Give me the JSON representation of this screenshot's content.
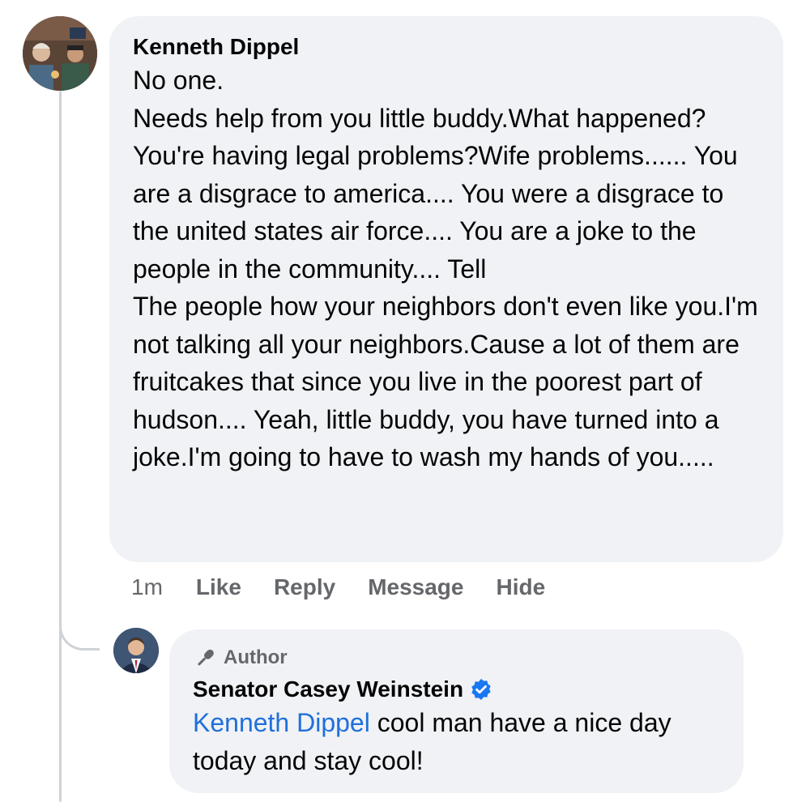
{
  "comment": {
    "author": "Kenneth Dippel",
    "paragraphs": [
      "No one.",
      "Needs help from you little buddy.What happened?You're having legal problems?Wife problems...... You are a disgrace to america.... You were a disgrace to the united states air force.... You are a joke to the people in the community.... Tell",
      "The people how your neighbors don't even like you.I'm not talking all your neighbors.Cause a lot of them are fruitcakes that since you live in the poorest part of hudson.... Yeah, little buddy, you have turned into a joke.I'm going to have to wash my hands of you....."
    ],
    "timestamp": "1m",
    "actions": {
      "like": "Like",
      "reply": "Reply",
      "message": "Message",
      "hide": "Hide"
    },
    "avatar_icon": "profile-photo-icon"
  },
  "reply": {
    "badge_label": "Author",
    "badge_icon": "microphone-icon",
    "author": "Senator Casey Weinstein",
    "verified_icon": "verified-badge-icon",
    "mention": "Kenneth Dippel",
    "text": " cool man have a nice day today and stay cool!",
    "avatar_icon": "profile-photo-icon"
  },
  "colors": {
    "bubble_background": "#f0f2f5",
    "secondary_text": "#65676b",
    "mention_link": "#216fdb",
    "verified_blue": "#1877f2",
    "thread_line": "#cfd2d6"
  }
}
